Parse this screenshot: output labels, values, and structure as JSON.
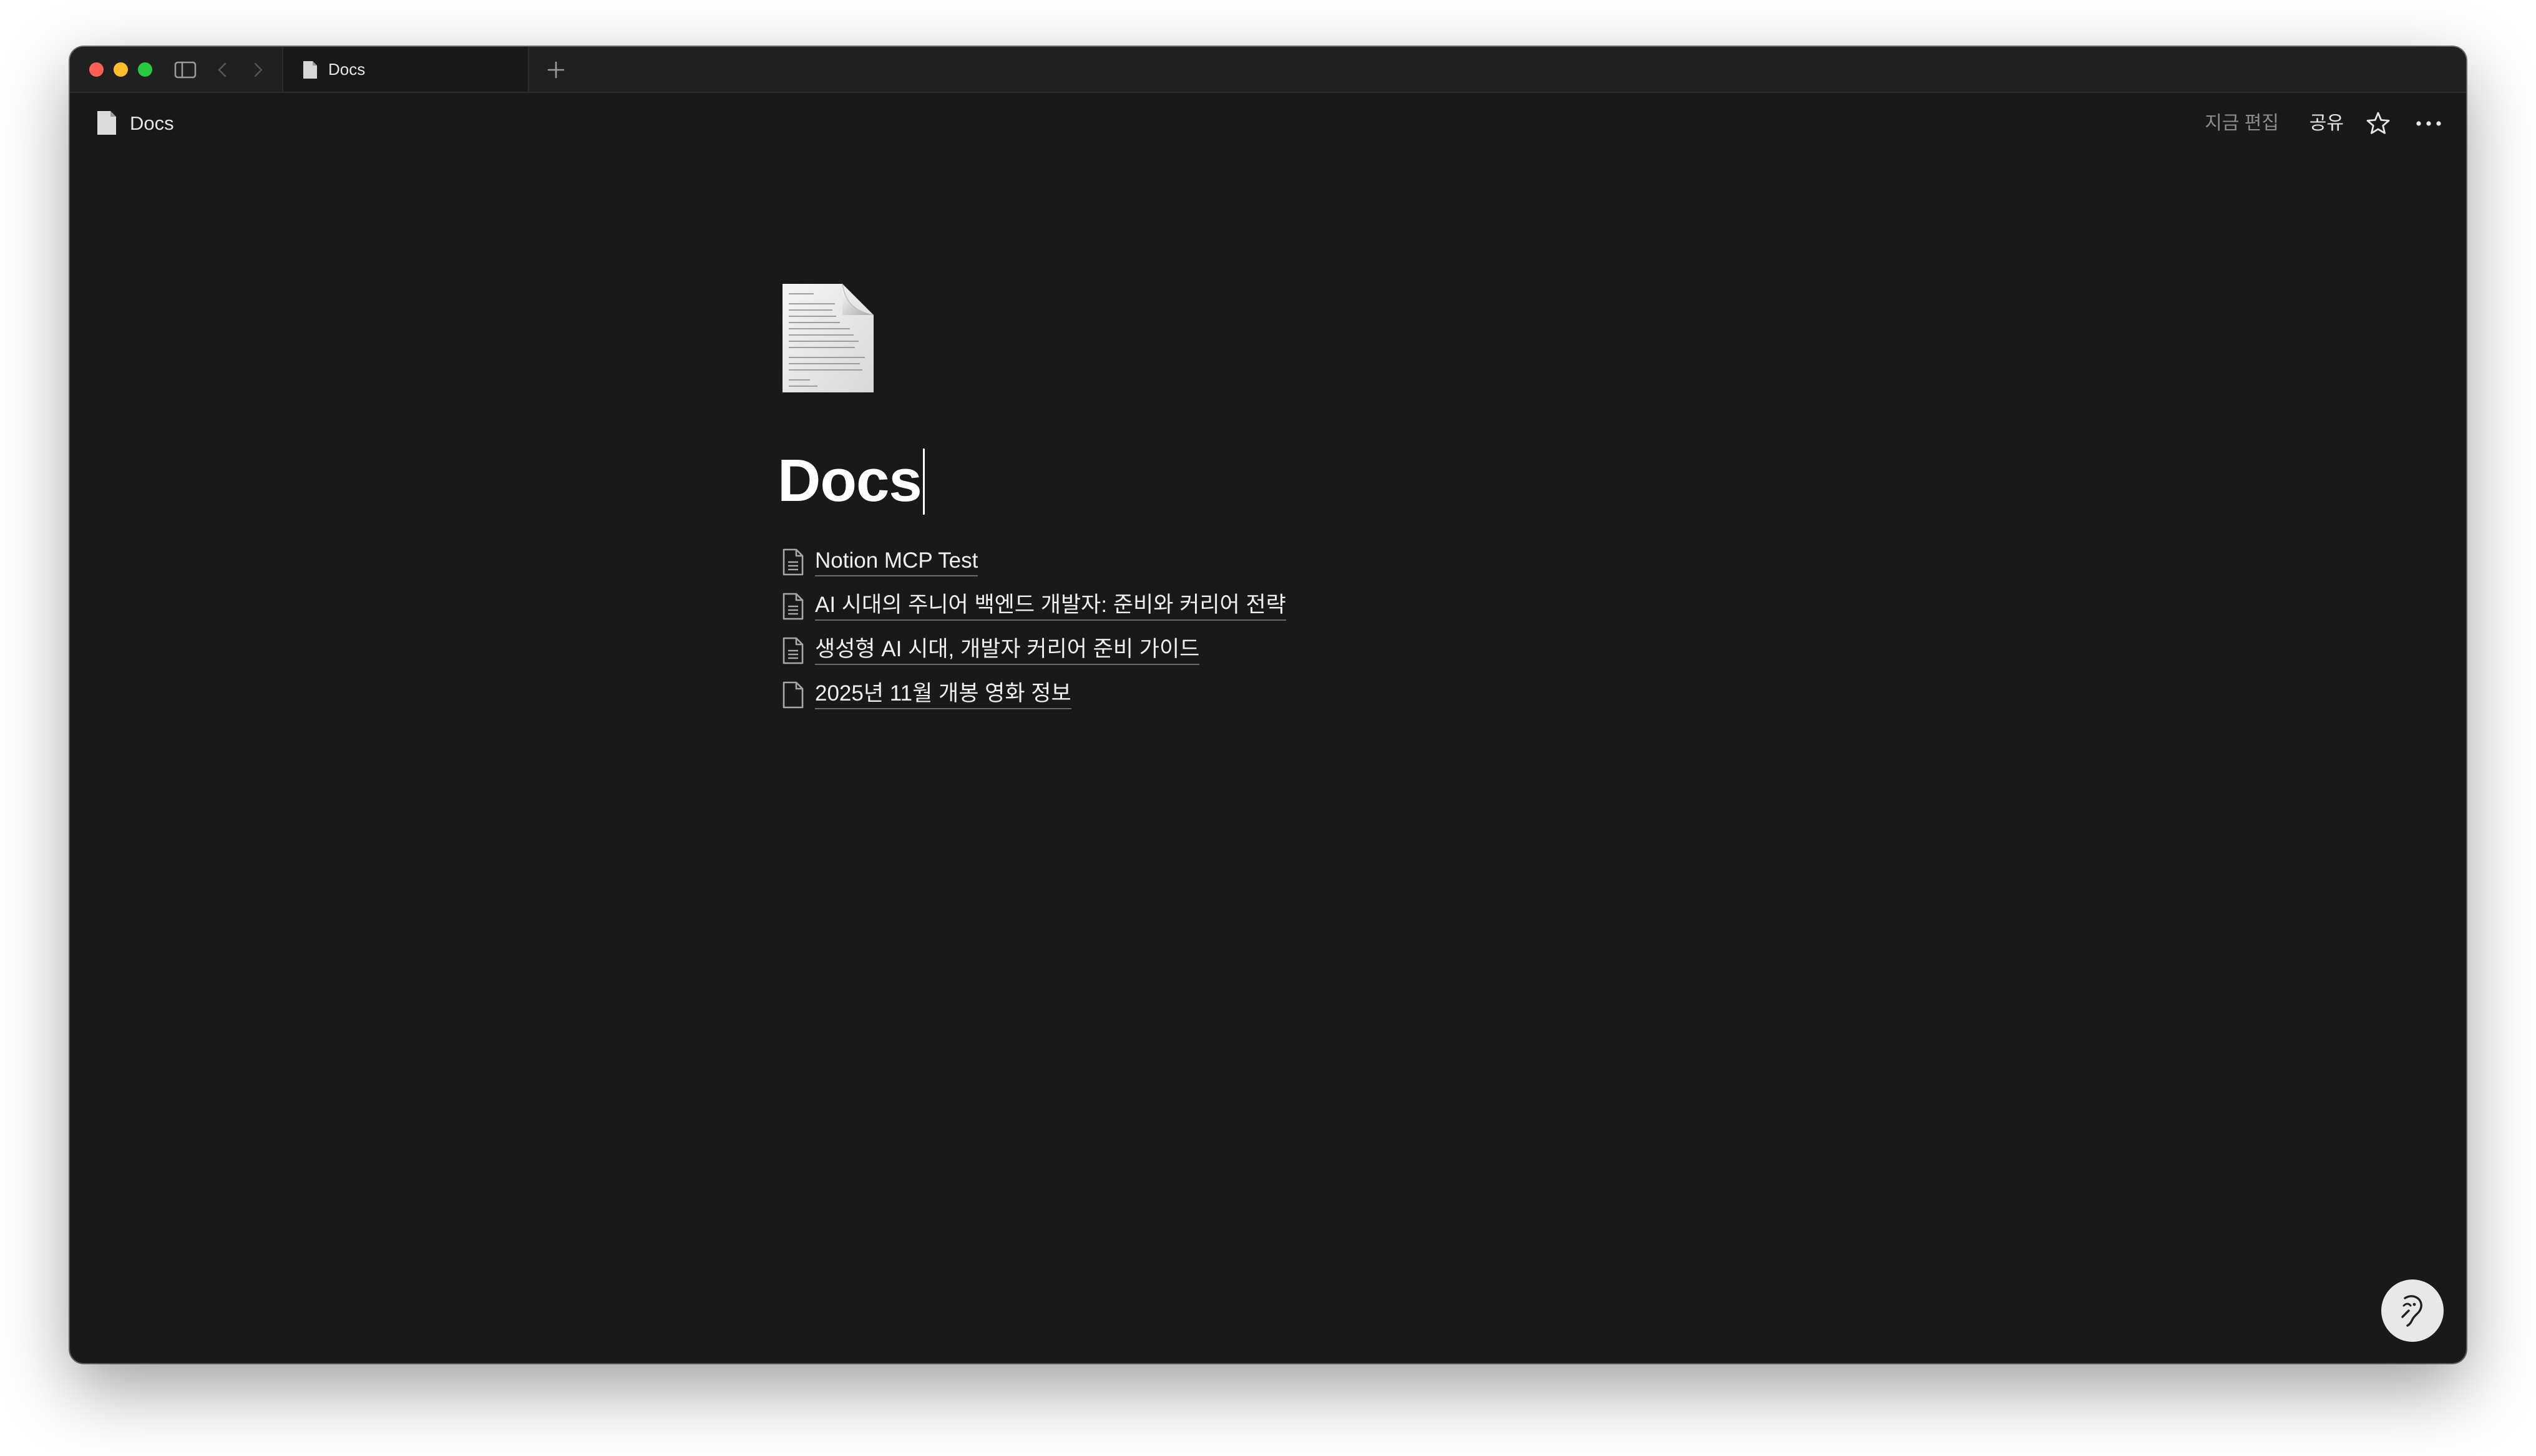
{
  "tab": {
    "label": "Docs"
  },
  "header": {
    "breadcrumb_label": "Docs",
    "edited_label": "지금 편집",
    "share_label": "공유"
  },
  "page": {
    "title": "Docs",
    "children": [
      {
        "label": "Notion MCP Test",
        "icon": "document-lines-icon"
      },
      {
        "label": "AI 시대의 주니어 백엔드 개발자: 준비와 커리어 전략",
        "icon": "document-lines-icon"
      },
      {
        "label": "생성형 AI 시대, 개발자 커리어 준비 가이드",
        "icon": "document-lines-icon"
      },
      {
        "label": "2025년 11월 개봉 영화 정보",
        "icon": "document-blank-icon"
      }
    ]
  },
  "colors": {
    "background": "#191919",
    "tabbar": "#202020",
    "text": "#f0f0f0",
    "muted": "#8c8c8c"
  }
}
